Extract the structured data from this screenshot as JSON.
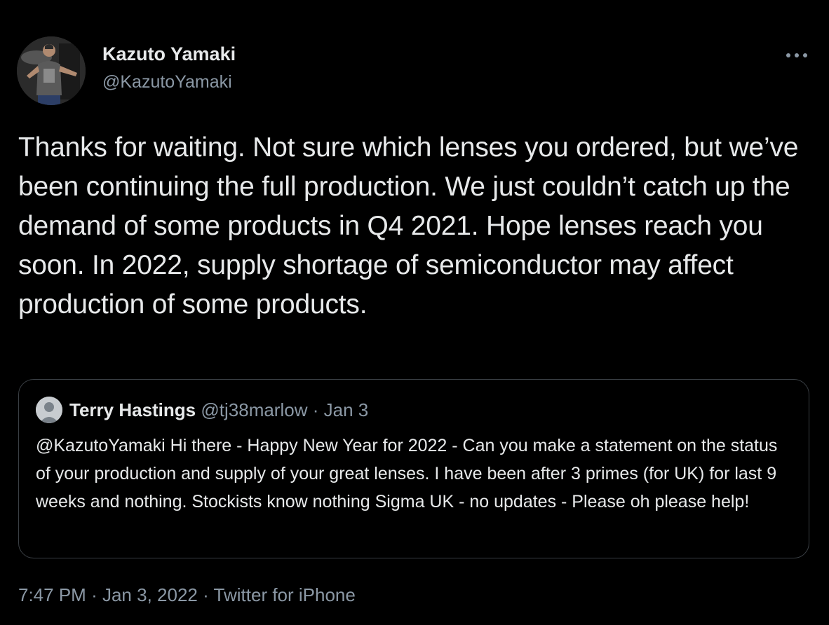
{
  "tweet": {
    "author": {
      "name": "Kazuto Yamaki",
      "handle": "@KazutoYamaki",
      "avatar_icon": "profile-photo"
    },
    "more_icon": "more-horizontal-icon",
    "text": "Thanks for waiting. Not sure which lenses you ordered, but we’ve been continuing the full production. We just couldn’t catch up the demand of some products in Q4 2021. Hope lenses reach you soon. In 2022, supply shortage of semiconductor may affect production of some products.",
    "quoted": {
      "name": "Terry Hastings",
      "handle": "@tj38marlow",
      "separator": "·",
      "date": "Jan 3",
      "avatar_icon": "default-avatar-icon",
      "text": "@KazutoYamaki Hi there - Happy New Year for 2022 - Can you make a statement on the status of your production and supply of your great lenses. I have been after 3 primes (for UK) for last 9 weeks and nothing. Stockists know nothing Sigma UK - no updates - Please oh please help!"
    },
    "meta": {
      "time": "7:47 PM",
      "separator": "·",
      "date": "Jan 3, 2022",
      "source": "Twitter for iPhone"
    }
  },
  "colors": {
    "background": "#000000",
    "text_primary": "#e7e9ea",
    "text_secondary": "#8b98a5",
    "card_border": "#3a3f44"
  }
}
